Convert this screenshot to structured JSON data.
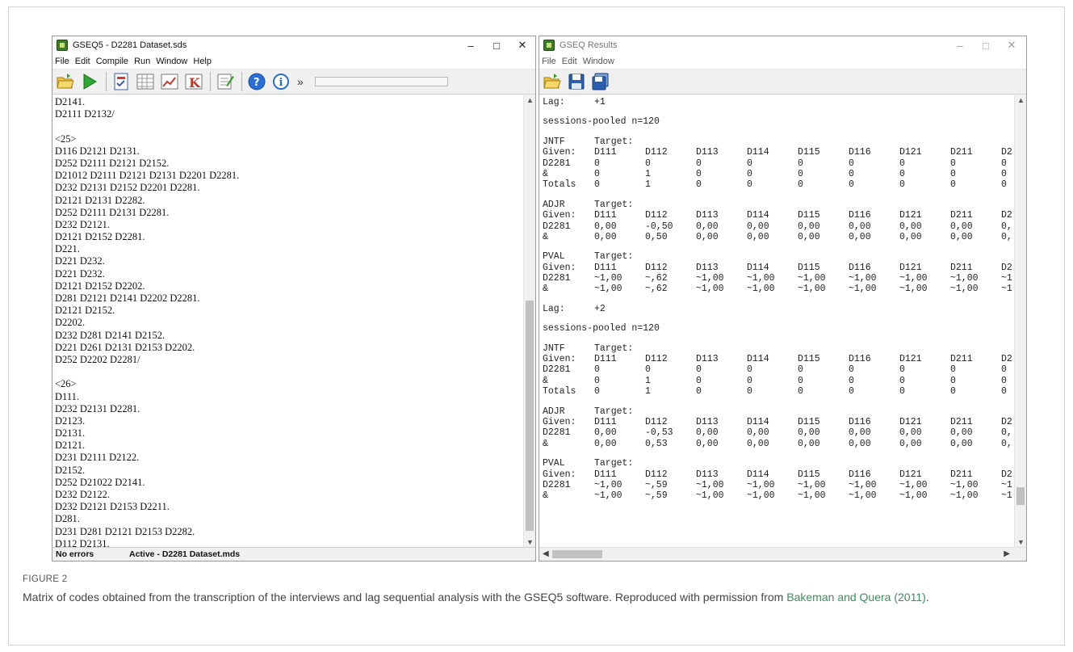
{
  "left_window": {
    "title": "GSEQ5 - D2281 Dataset.sds",
    "controls": [
      "–",
      "□",
      "✕"
    ],
    "menu": [
      "File",
      "Edit",
      "Compile",
      "Run",
      "Window",
      "Help"
    ],
    "toolbar_icons": [
      "open-folder-icon",
      "run-icon",
      "checklist-icon",
      "table-grid-icon",
      "chart-icon",
      "kappa-icon",
      "notes-icon",
      "help-icon",
      "info-icon"
    ],
    "overflow": "»",
    "editor_lines": [
      "D2141.",
      "D2111 D2132/",
      "",
      "<25>",
      "D116 D2121 D2131.",
      "D252 D2111 D2121 D2152.",
      "D21012 D2111 D2121 D2131 D2201 D2281.",
      "D232 D2131 D2152 D2201 D2281.",
      "D2121 D2131 D2282.",
      "D252 D2111 D2131 D2281.",
      "D232 D2121.",
      "D2121 D2152 D2281.",
      "D221.",
      "D221 D232.",
      "D221 D232.",
      "D2121 D2152 D2202.",
      "D281 D2121 D2141 D2202 D2281.",
      "D2121 D2152.",
      "D2202.",
      "D232 D281 D2141 D2152.",
      "D221 D261 D2131 D2153 D2202.",
      "D252 D2202 D2281/",
      "",
      "<26>",
      "D111.",
      "D232 D2131 D2281.",
      "D2123.",
      "D2131.",
      "D2121.",
      "D231 D2111 D2122.",
      "D2152.",
      "D252 D21022 D2141.",
      "D232 D2122.",
      "D232 D2121 D2153 D2211.",
      "D281.",
      "D231 D281 D2121 D2153 D2282.",
      "D112 D2131."
    ],
    "status": {
      "errors": "No errors",
      "active": "Active - D2281 Dataset.mds"
    }
  },
  "right_window": {
    "title": "GSEQ Results",
    "controls": [
      "–",
      "□",
      "✕"
    ],
    "menu": [
      "File",
      "Edit",
      "Window"
    ],
    "toolbar_icons": [
      "open-folder-icon",
      "save-icon",
      "save-all-icon"
    ],
    "lag_blocks": [
      {
        "lag_label": "Lag:",
        "lag_value": "+1",
        "pooled": "sessions-pooled n=120",
        "tables": [
          {
            "name": "JNTF",
            "target": "Target:",
            "header": [
              "Given:",
              "D111",
              "D112",
              "D113",
              "D114",
              "D115",
              "D116",
              "D121",
              "D211",
              "D2"
            ],
            "rows": [
              [
                "D2281",
                "0",
                "0",
                "0",
                "0",
                "0",
                "0",
                "0",
                "0",
                "0"
              ],
              [
                "&",
                "0",
                "1",
                "0",
                "0",
                "0",
                "0",
                "0",
                "0",
                "0"
              ],
              [
                "Totals",
                "0",
                "1",
                "0",
                "0",
                "0",
                "0",
                "0",
                "0",
                "0"
              ]
            ]
          },
          {
            "name": "ADJR",
            "target": "Target:",
            "header": [
              "Given:",
              "D111",
              "D112",
              "D113",
              "D114",
              "D115",
              "D116",
              "D121",
              "D211",
              "D2"
            ],
            "rows": [
              [
                "D2281",
                "0,00",
                "-0,50",
                "0,00",
                "0,00",
                "0,00",
                "0,00",
                "0,00",
                "0,00",
                "0,"
              ],
              [
                "&",
                "0,00",
                "0,50",
                "0,00",
                "0,00",
                "0,00",
                "0,00",
                "0,00",
                "0,00",
                "0,"
              ]
            ]
          },
          {
            "name": "PVAL",
            "target": "Target:",
            "header": [
              "Given:",
              "D111",
              "D112",
              "D113",
              "D114",
              "D115",
              "D116",
              "D121",
              "D211",
              "D2"
            ],
            "rows": [
              [
                "D2281",
                "~1,00",
                "~,62",
                "~1,00",
                "~1,00",
                "~1,00",
                "~1,00",
                "~1,00",
                "~1,00",
                "~1"
              ],
              [
                "&",
                "~1,00",
                "~,62",
                "~1,00",
                "~1,00",
                "~1,00",
                "~1,00",
                "~1,00",
                "~1,00",
                "~1"
              ]
            ]
          }
        ]
      },
      {
        "lag_label": "Lag:",
        "lag_value": "+2",
        "pooled": "sessions-pooled n=120",
        "tables": [
          {
            "name": "JNTF",
            "target": "Target:",
            "header": [
              "Given:",
              "D111",
              "D112",
              "D113",
              "D114",
              "D115",
              "D116",
              "D121",
              "D211",
              "D2"
            ],
            "rows": [
              [
                "D2281",
                "0",
                "0",
                "0",
                "0",
                "0",
                "0",
                "0",
                "0",
                "0"
              ],
              [
                "&",
                "0",
                "1",
                "0",
                "0",
                "0",
                "0",
                "0",
                "0",
                "0"
              ],
              [
                "Totals",
                "0",
                "1",
                "0",
                "0",
                "0",
                "0",
                "0",
                "0",
                "0"
              ]
            ]
          },
          {
            "name": "ADJR",
            "target": "Target:",
            "header": [
              "Given:",
              "D111",
              "D112",
              "D113",
              "D114",
              "D115",
              "D116",
              "D121",
              "D211",
              "D2"
            ],
            "rows": [
              [
                "D2281",
                "0,00",
                "-0,53",
                "0,00",
                "0,00",
                "0,00",
                "0,00",
                "0,00",
                "0,00",
                "0,"
              ],
              [
                "&",
                "0,00",
                "0,53",
                "0,00",
                "0,00",
                "0,00",
                "0,00",
                "0,00",
                "0,00",
                "0,"
              ]
            ]
          },
          {
            "name": "PVAL",
            "target": "Target:",
            "header": [
              "Given:",
              "D111",
              "D112",
              "D113",
              "D114",
              "D115",
              "D116",
              "D121",
              "D211",
              "D2"
            ],
            "rows": [
              [
                "D2281",
                "~1,00",
                "~,59",
                "~1,00",
                "~1,00",
                "~1,00",
                "~1,00",
                "~1,00",
                "~1,00",
                "~1"
              ],
              [
                "&",
                "~1,00",
                "~,59",
                "~1,00",
                "~1,00",
                "~1,00",
                "~1,00",
                "~1,00",
                "~1,00",
                "~1"
              ]
            ]
          }
        ]
      }
    ]
  },
  "caption": {
    "label": "FIGURE 2",
    "text": "Matrix of codes obtained from the transcription of the interviews and lag sequential analysis with the GSEQ5 software. Reproduced with permission from ",
    "citation": "Bakeman and Quera (2011)",
    "suffix": "."
  }
}
